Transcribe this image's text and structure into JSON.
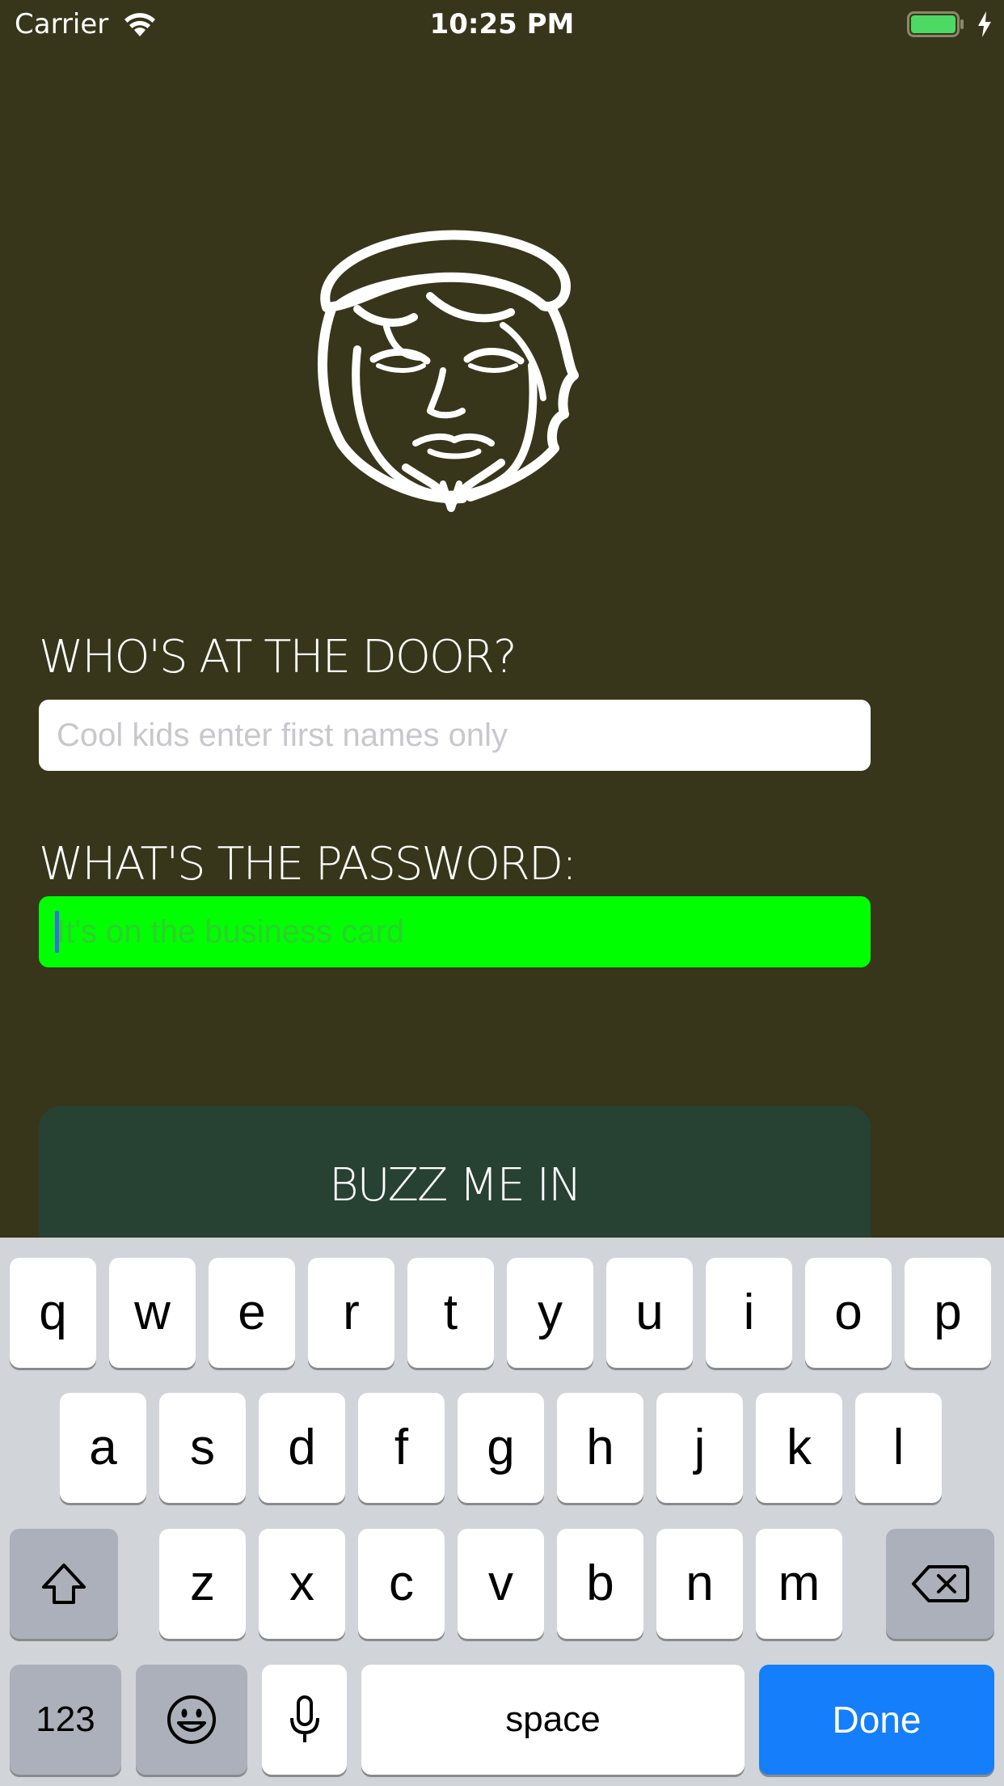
{
  "status_bar": {
    "carrier": "Carrier",
    "time": "10:25 PM",
    "icons": [
      "wifi-icon",
      "battery-icon",
      "charging-bolt-icon"
    ]
  },
  "logo": {
    "icon": "bearded-face-logo-icon"
  },
  "form": {
    "name_label": "WHO'S AT THE DOOR?",
    "name_placeholder": "Cool kids enter first names only",
    "name_value": "",
    "password_label": "WHAT'S THE PASSWORD:",
    "password_placeholder": "It's on the business card",
    "password_value": "",
    "submit_label": "BUZZ ME IN"
  },
  "colors": {
    "background": "#37361b",
    "password_field_focus": "#00ff00",
    "button_background": "#274133",
    "keyboard_done": "#147efb"
  },
  "keyboard": {
    "row1": [
      "q",
      "w",
      "e",
      "r",
      "t",
      "y",
      "u",
      "i",
      "o",
      "p"
    ],
    "row2": [
      "a",
      "s",
      "d",
      "f",
      "g",
      "h",
      "j",
      "k",
      "l"
    ],
    "row3": [
      "z",
      "x",
      "c",
      "v",
      "b",
      "n",
      "m"
    ],
    "numbers_label": "123",
    "space_label": "space",
    "done_label": "Done",
    "special_icons": [
      "shift-icon",
      "backspace-icon",
      "emoji-icon",
      "microphone-icon"
    ]
  }
}
